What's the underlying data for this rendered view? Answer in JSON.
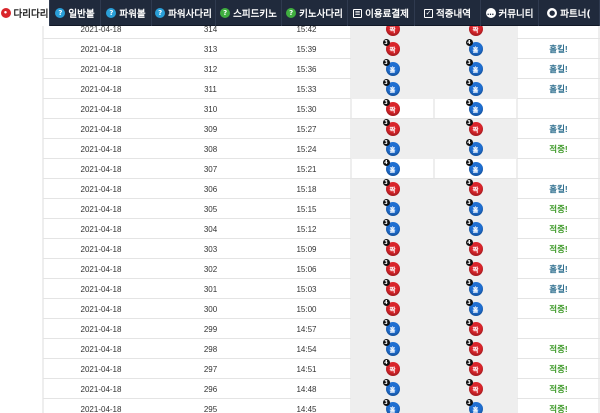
{
  "nav": {
    "tabs": [
      {
        "label": "다리다리",
        "icon": "circle-dot-icon",
        "icon_color": "#d9252b",
        "active": true
      },
      {
        "label": "일반볼",
        "icon": "question-circle-icon",
        "icon_color": "#2a9fd8",
        "active": false
      },
      {
        "label": "파워볼",
        "icon": "question-circle-icon",
        "icon_color": "#2a9fd8",
        "active": false
      },
      {
        "label": "파워사다리",
        "icon": "question-circle-icon",
        "icon_color": "#2a9fd8",
        "active": false
      },
      {
        "label": "스피드키노",
        "icon": "question-circle-icon",
        "icon_color": "#3fae3f",
        "active": false
      },
      {
        "label": "키노사다리",
        "icon": "question-circle-icon",
        "icon_color": "#3fae3f",
        "active": false
      },
      {
        "label": "이용료결제",
        "icon": "receipt-icon",
        "icon_color": "#ffffff",
        "active": false
      },
      {
        "label": "적중내역",
        "icon": "checkbox-icon",
        "icon_color": "#ffffff",
        "active": false
      },
      {
        "label": "커뮤니티",
        "icon": "chat-icon",
        "icon_color": "#ffffff",
        "active": false
      },
      {
        "label": "파트너(",
        "icon": "user-icon",
        "icon_color": "#ffffff",
        "active": false
      }
    ]
  },
  "colors": {
    "red_ball": "#d9252b",
    "blue_ball": "#1f6fd1",
    "hit": "#3f9a2a",
    "miss": "#2f6f8f",
    "nav_bg": "#202a3c"
  },
  "rows": [
    {
      "date": "2021-04-18",
      "round": "314",
      "time": "15:42",
      "p1": {
        "label": "짝",
        "color": "red",
        "num": "3"
      },
      "p2": {
        "label": "짝",
        "color": "red",
        "num": "3"
      },
      "result": "",
      "shade": true
    },
    {
      "date": "2021-04-18",
      "round": "313",
      "time": "15:39",
      "p1": {
        "label": "짝",
        "color": "red",
        "num": "3"
      },
      "p2": {
        "label": "홀",
        "color": "blue",
        "num": "4"
      },
      "result": "홀킬!",
      "shade": true
    },
    {
      "date": "2021-04-18",
      "round": "312",
      "time": "15:36",
      "p1": {
        "label": "홀",
        "color": "blue",
        "num": "3"
      },
      "p2": {
        "label": "홀",
        "color": "blue",
        "num": "3"
      },
      "result": "홀킬!",
      "shade": true
    },
    {
      "date": "2021-04-18",
      "round": "311",
      "time": "15:33",
      "p1": {
        "label": "홀",
        "color": "blue",
        "num": "3"
      },
      "p2": {
        "label": "홀",
        "color": "blue",
        "num": "3"
      },
      "result": "홀킬!",
      "shade": true
    },
    {
      "date": "2021-04-18",
      "round": "310",
      "time": "15:30",
      "p1": {
        "label": "짝",
        "color": "red",
        "num": "3"
      },
      "p2": {
        "label": "홀",
        "color": "blue",
        "num": "3"
      },
      "result": "",
      "shade": false
    },
    {
      "date": "2021-04-18",
      "round": "309",
      "time": "15:27",
      "p1": {
        "label": "짝",
        "color": "red",
        "num": "3"
      },
      "p2": {
        "label": "짝",
        "color": "red",
        "num": "3"
      },
      "result": "홀킬!",
      "shade": true
    },
    {
      "date": "2021-04-18",
      "round": "308",
      "time": "15:24",
      "p1": {
        "label": "홀",
        "color": "blue",
        "num": "3"
      },
      "p2": {
        "label": "홀",
        "color": "blue",
        "num": "4"
      },
      "result": "적중!",
      "shade": true
    },
    {
      "date": "2021-04-18",
      "round": "307",
      "time": "15:21",
      "p1": {
        "label": "홀",
        "color": "blue",
        "num": "4"
      },
      "p2": {
        "label": "홀",
        "color": "blue",
        "num": "3"
      },
      "result": "",
      "shade": false
    },
    {
      "date": "2021-04-18",
      "round": "306",
      "time": "15:18",
      "p1": {
        "label": "짝",
        "color": "red",
        "num": "3"
      },
      "p2": {
        "label": "짝",
        "color": "red",
        "num": "3"
      },
      "result": "홀킬!",
      "shade": true
    },
    {
      "date": "2021-04-18",
      "round": "305",
      "time": "15:15",
      "p1": {
        "label": "홀",
        "color": "blue",
        "num": "3"
      },
      "p2": {
        "label": "홀",
        "color": "blue",
        "num": "3"
      },
      "result": "적중!",
      "shade": true
    },
    {
      "date": "2021-04-18",
      "round": "304",
      "time": "15:12",
      "p1": {
        "label": "홀",
        "color": "blue",
        "num": "3"
      },
      "p2": {
        "label": "홀",
        "color": "blue",
        "num": "3"
      },
      "result": "적중!",
      "shade": true
    },
    {
      "date": "2021-04-18",
      "round": "303",
      "time": "15:09",
      "p1": {
        "label": "짝",
        "color": "red",
        "num": "3"
      },
      "p2": {
        "label": "짝",
        "color": "red",
        "num": "4"
      },
      "result": "적중!",
      "shade": true
    },
    {
      "date": "2021-04-18",
      "round": "302",
      "time": "15:06",
      "p1": {
        "label": "짝",
        "color": "red",
        "num": "3"
      },
      "p2": {
        "label": "짝",
        "color": "red",
        "num": "3"
      },
      "result": "홀킬!",
      "shade": true
    },
    {
      "date": "2021-04-18",
      "round": "301",
      "time": "15:03",
      "p1": {
        "label": "짝",
        "color": "red",
        "num": "3"
      },
      "p2": {
        "label": "홀",
        "color": "blue",
        "num": "3"
      },
      "result": "홀킬!",
      "shade": true
    },
    {
      "date": "2021-04-18",
      "round": "300",
      "time": "15:00",
      "p1": {
        "label": "짝",
        "color": "red",
        "num": "4"
      },
      "p2": {
        "label": "홀",
        "color": "blue",
        "num": "3"
      },
      "result": "적중!",
      "shade": true
    },
    {
      "date": "2021-04-18",
      "round": "299",
      "time": "14:57",
      "p1": {
        "label": "홀",
        "color": "blue",
        "num": "3"
      },
      "p2": {
        "label": "짝",
        "color": "red",
        "num": "3"
      },
      "result": "",
      "shade": true
    },
    {
      "date": "2021-04-18",
      "round": "298",
      "time": "14:54",
      "p1": {
        "label": "홀",
        "color": "blue",
        "num": "3"
      },
      "p2": {
        "label": "짝",
        "color": "red",
        "num": "3"
      },
      "result": "적중!",
      "shade": true
    },
    {
      "date": "2021-04-18",
      "round": "297",
      "time": "14:51",
      "p1": {
        "label": "짝",
        "color": "red",
        "num": "4"
      },
      "p2": {
        "label": "짝",
        "color": "red",
        "num": "3"
      },
      "result": "적중!",
      "shade": true
    },
    {
      "date": "2021-04-18",
      "round": "296",
      "time": "14:48",
      "p1": {
        "label": "홀",
        "color": "blue",
        "num": "3"
      },
      "p2": {
        "label": "짝",
        "color": "red",
        "num": "3"
      },
      "result": "적중!",
      "shade": true
    },
    {
      "date": "2021-04-18",
      "round": "295",
      "time": "14:45",
      "p1": {
        "label": "홀",
        "color": "blue",
        "num": "3"
      },
      "p2": {
        "label": "홀",
        "color": "blue",
        "num": "3"
      },
      "result": "적중!",
      "shade": true
    }
  ]
}
